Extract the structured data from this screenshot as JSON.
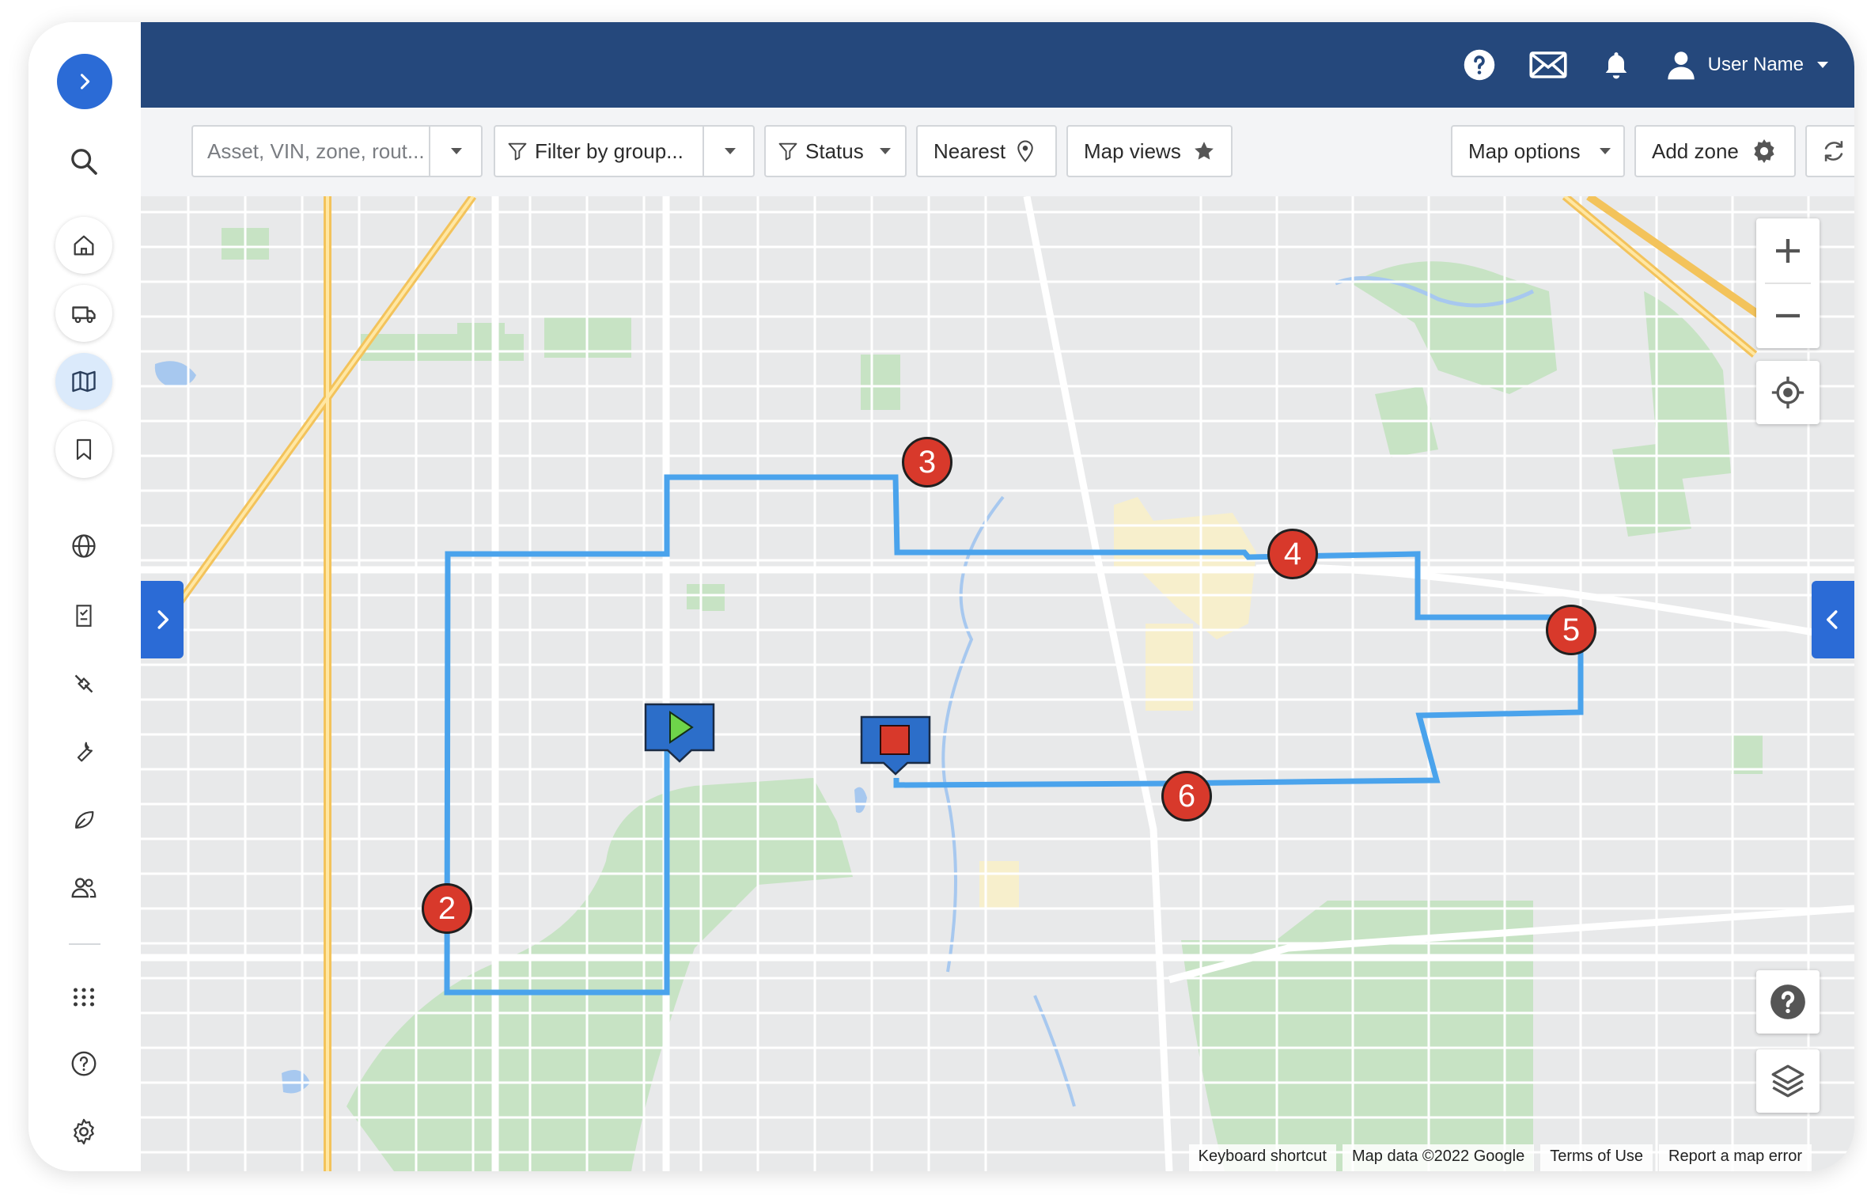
{
  "sidebar": {
    "expand_icon": "chevron-right-icon",
    "items": [
      {
        "name": "search",
        "icon": "search-icon"
      },
      {
        "name": "home",
        "icon": "home-icon"
      },
      {
        "name": "vehicles",
        "icon": "truck-icon"
      },
      {
        "name": "map",
        "icon": "map-icon",
        "active": true
      },
      {
        "name": "bookmarks",
        "icon": "bookmark-icon"
      },
      {
        "name": "globe",
        "icon": "globe-icon"
      },
      {
        "name": "reports",
        "icon": "report-icon"
      },
      {
        "name": "routes",
        "icon": "route-icon"
      },
      {
        "name": "maintenance",
        "icon": "wrench-icon"
      },
      {
        "name": "sustainability",
        "icon": "leaf-icon"
      },
      {
        "name": "people",
        "icon": "people-icon"
      },
      {
        "name": "apps",
        "icon": "apps-grid-icon"
      },
      {
        "name": "help",
        "icon": "help-icon"
      },
      {
        "name": "settings",
        "icon": "gear-icon"
      }
    ]
  },
  "header": {
    "icons": [
      "help-icon",
      "mail-icon",
      "bell-icon",
      "user-icon"
    ],
    "user_name": "User Name"
  },
  "toolbar": {
    "search_placeholder": "Asset, VIN, zone, rout...",
    "filter_group": "Filter by group...",
    "status": "Status",
    "nearest": "Nearest",
    "map_views": "Map views",
    "map_options": "Map options",
    "add_zone": "Add zone"
  },
  "map": {
    "route_color": "#4aa3ec",
    "stops": [
      "2",
      "3",
      "4",
      "5",
      "6"
    ],
    "start_icon": "play-icon",
    "end_icon": "stop-icon",
    "controls": [
      "zoom-in-icon",
      "zoom-out-icon",
      "locate-icon",
      "help-icon",
      "layers-icon"
    ],
    "footer": {
      "keyboard": "Keyboard shortcut",
      "data": "Map data ©2022 Google",
      "terms": "Terms of Use",
      "report": "Report a map error"
    }
  },
  "colors": {
    "header_bg": "#25487c",
    "accent": "#2b6bd6",
    "marker": "#d8392b"
  }
}
